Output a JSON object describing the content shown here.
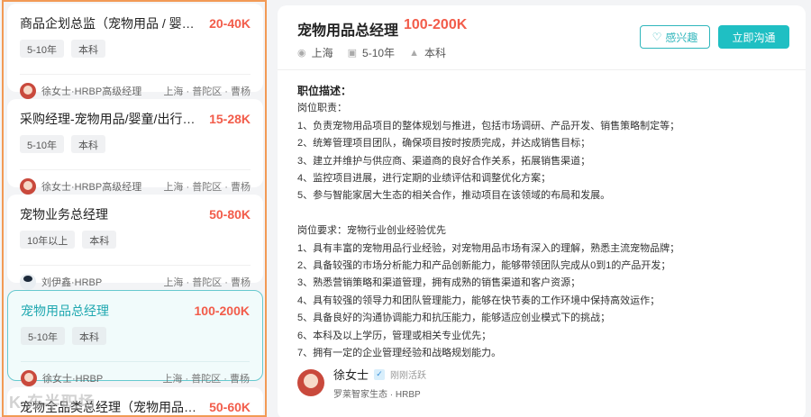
{
  "jobs": [
    {
      "title": "商品企划总监（宠物用品 / 婴童用品）",
      "salary": "20-40K",
      "tags": [
        "5-10年",
        "本科"
      ],
      "hr": "徐女士·HRBP高级经理",
      "location": "上海 · 普陀区 · 曹杨"
    },
    {
      "title": "采购经理-宠物用品/婴童/出行用品/智...",
      "salary": "15-28K",
      "tags": [
        "5-10年",
        "本科"
      ],
      "hr": "徐女士·HRBP高级经理",
      "location": "上海 · 普陀区 · 曹杨"
    },
    {
      "title": "宠物业务总经理",
      "salary": "50-80K",
      "tags": [
        "10年以上",
        "本科"
      ],
      "hr": "刘伊鑫·HRBP",
      "location": "上海 · 普陀区 · 曹杨"
    },
    {
      "title": "宠物用品总经理",
      "salary": "100-200K",
      "tags": [
        "5-10年",
        "本科"
      ],
      "hr": "徐女士·HRBP",
      "location": "上海 · 普陀区 · 曹杨"
    },
    {
      "title": "宠物全品类总经理（宠物用品与护理）",
      "salary": "50-60K"
    }
  ],
  "watermark": "K 东半职场",
  "detail": {
    "title": "宠物用品总经理",
    "salary": "100-200K",
    "city": "上海",
    "experience": "5-10年",
    "education": "本科",
    "like_label": "感兴趣",
    "chat_label": "立即沟通",
    "desc_heading": "职位描述：",
    "duties_heading": "岗位职责：",
    "duties": [
      "1、负责宠物用品项目的整体规划与推进，包括市场调研、产品开发、销售策略制定等；",
      "2、统筹管理项目团队，确保项目按时按质完成，并达成销售目标；",
      "3、建立并维护与供应商、渠道商的良好合作关系，拓展销售渠道；",
      "4、监控项目进展，进行定期的业绩评估和调整优化方案；",
      "5、参与智能家居大生态的相关合作，推动项目在该领域的布局和发展。"
    ],
    "req_heading": "岗位要求：宠物行业创业经验优先",
    "requirements": [
      "1、具有丰富的宠物用品行业经验，对宠物用品市场有深入的理解，熟悉主流宠物品牌；",
      "2、具备较强的市场分析能力和产品创新能力，能够带领团队完成从0到1的产品开发；",
      "3、熟悉营销策略和渠道管理，拥有成熟的销售渠道和客户资源；",
      "4、具有较强的领导力和团队管理能力，能够在快节奏的工作环境中保持高效运作；",
      "5、具备良好的沟通协调能力和抗压能力，能够适应创业模式下的挑战；",
      "6、本科及以上学历，管理或相关专业优先；",
      "7、拥有一定的企业管理经验和战略规划能力。"
    ],
    "contact": {
      "name": "徐女士",
      "status": "刚刚活跃",
      "org": "罗莱智家生态 · HRBP"
    }
  }
}
